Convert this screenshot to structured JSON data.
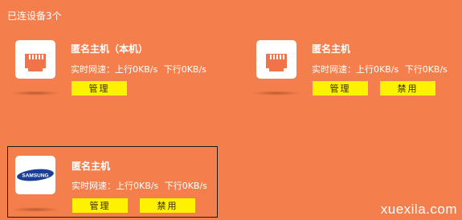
{
  "section_title": "已连设备3个",
  "devices": [
    {
      "name": "匿名主机（本机）",
      "speed_label": "实时网速：",
      "up": "上行0KB/s",
      "down": "下行0KB/s",
      "manage_label": "管理",
      "ban_label": "",
      "icon": "ethernet-port-icon"
    },
    {
      "name": "匿名主机",
      "speed_label": "实时网速：",
      "up": "上行0KB/s",
      "down": "下行0KB/s",
      "manage_label": "管理",
      "ban_label": "禁用",
      "icon": "ethernet-port-icon"
    },
    {
      "name": "匿名主机",
      "speed_label": "实时网速：",
      "up": "上行0KB/s",
      "down": "下行0KB/s",
      "manage_label": "管理",
      "ban_label": "禁用",
      "icon": "samsung-logo-icon",
      "logo_text": "SAMSUNG"
    }
  ],
  "watermark": "xuexila.com",
  "colors": {
    "background": "#f47f4d",
    "button": "#fff200",
    "port_icon": "#f1734a",
    "samsung_blue": "#1b3f96"
  }
}
